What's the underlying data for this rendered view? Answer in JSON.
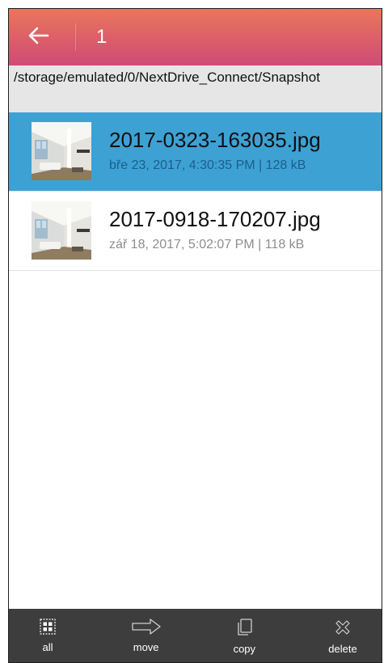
{
  "header": {
    "selection_count": "1"
  },
  "path": {
    "text": "/storage/emulated/0/NextDrive_Connect/Snapshot"
  },
  "files": [
    {
      "name": "2017-0323-163035.jpg",
      "meta": "bře 23, 2017, 4:30:35 PM | 128 kB",
      "selected": true
    },
    {
      "name": "2017-0918-170207.jpg",
      "meta": "zář 18, 2017, 5:02:07 PM | 118 kB",
      "selected": false
    }
  ],
  "toolbar": {
    "all": "all",
    "move": "move",
    "copy": "copy",
    "delete": "delete"
  },
  "colors": {
    "header_gradient_top": "#e9775c",
    "header_gradient_bottom": "#cf4b78",
    "selected_row": "#3ea1d4",
    "toolbar_bg": "#3d3d3d"
  }
}
